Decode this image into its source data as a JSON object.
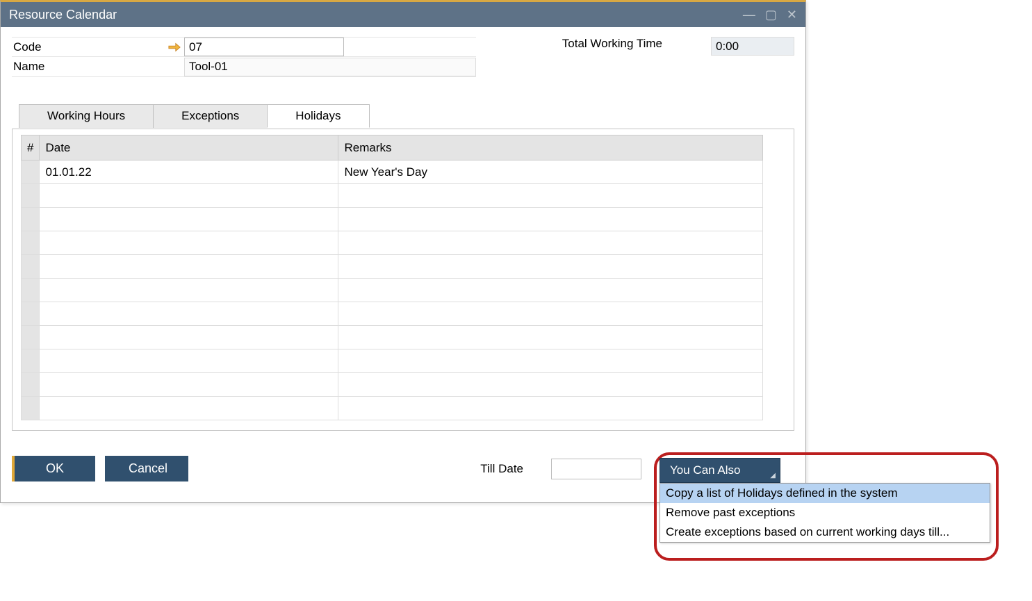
{
  "window": {
    "title": "Resource Calendar"
  },
  "form": {
    "code_label": "Code",
    "code_value": "07",
    "name_label": "Name",
    "name_value": "Tool-01",
    "total_working_label": "Total Working Time",
    "total_working_value": "0:00"
  },
  "tabs": {
    "working_hours": "Working Hours",
    "exceptions": "Exceptions",
    "holidays": "Holidays"
  },
  "table": {
    "col_num": "#",
    "col_date": "Date",
    "col_remarks": "Remarks",
    "rows": [
      {
        "date": "01.01.22",
        "remarks": "New Year's Day"
      }
    ]
  },
  "footer": {
    "ok": "OK",
    "cancel": "Cancel",
    "till_date_label": "Till Date",
    "till_date_value": ""
  },
  "dropdown": {
    "label": "You Can Also",
    "items": [
      "Copy a list of Holidays defined in the system",
      "Remove past exceptions",
      "Create exceptions based on current working days till..."
    ]
  }
}
